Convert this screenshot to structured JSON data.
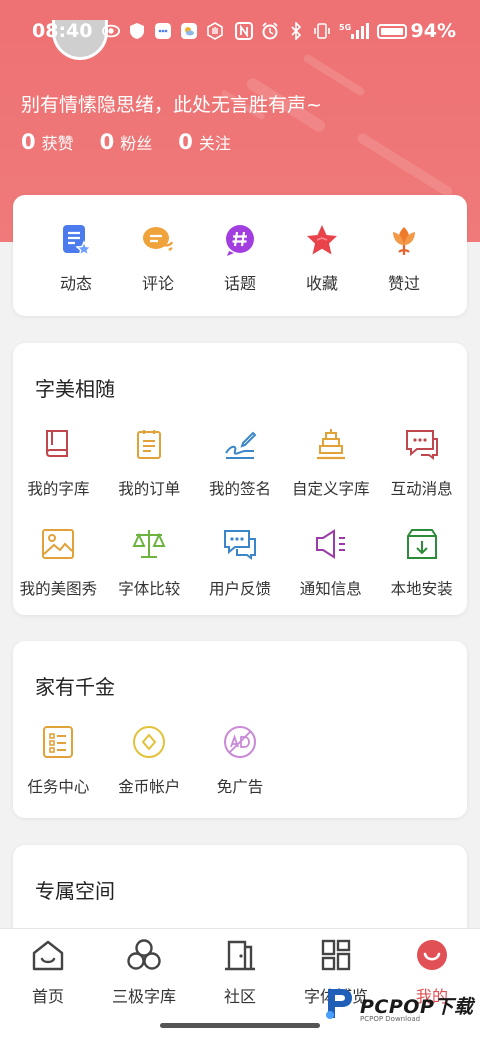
{
  "status_bar": {
    "time": "08:40",
    "battery": "94%",
    "signal": "5G"
  },
  "profile": {
    "motto": "别有情愫隐思绪，此处无言胜有声~",
    "stats": [
      {
        "num": "0",
        "label": "获赞"
      },
      {
        "num": "0",
        "label": "粉丝"
      },
      {
        "num": "0",
        "label": "关注"
      }
    ]
  },
  "quick_actions": [
    {
      "label": "动态",
      "icon": "post-icon",
      "color": "#4b7bec"
    },
    {
      "label": "评论",
      "icon": "comment-icon",
      "color": "#f0a33a"
    },
    {
      "label": "话题",
      "icon": "topic-icon",
      "color": "#a23ee0"
    },
    {
      "label": "收藏",
      "icon": "star-icon",
      "color": "#e8434b"
    },
    {
      "label": "赞过",
      "icon": "flower-icon",
      "color": "#f07a2c"
    }
  ],
  "section_ziti": {
    "title": "字美相随",
    "items": [
      {
        "label": "我的字库",
        "icon": "book-icon",
        "color": "#c0474d"
      },
      {
        "label": "我的订单",
        "icon": "clipboard-icon",
        "color": "#e1a23a"
      },
      {
        "label": "我的签名",
        "icon": "signature-icon",
        "color": "#3a86c8"
      },
      {
        "label": "自定义字库",
        "icon": "stack-icon",
        "color": "#e1a23a"
      },
      {
        "label": "互动消息",
        "icon": "message-icon",
        "color": "#c0474d"
      },
      {
        "label": "我的美图秀",
        "icon": "image-icon",
        "color": "#e1a23a"
      },
      {
        "label": "字体比较",
        "icon": "scale-icon",
        "color": "#6cb33f"
      },
      {
        "label": "用户反馈",
        "icon": "feedback-icon",
        "color": "#3a86c8"
      },
      {
        "label": "通知信息",
        "icon": "speaker-icon",
        "color": "#9b3aa8"
      },
      {
        "label": "本地安装",
        "icon": "download-box-icon",
        "color": "#2e8b3a"
      }
    ]
  },
  "section_jiayou": {
    "title": "家有千金",
    "items": [
      {
        "label": "任务中心",
        "icon": "task-icon",
        "color": "#e1a23a"
      },
      {
        "label": "金币帐户",
        "icon": "coin-icon",
        "color": "#e1c23a"
      },
      {
        "label": "免广告",
        "icon": "no-ad-icon",
        "color": "#c98ad8"
      }
    ]
  },
  "section_zhuanshu": {
    "title": "专属空间"
  },
  "bottom_nav": [
    {
      "label": "首页",
      "icon": "home-icon"
    },
    {
      "label": "三极字库",
      "icon": "circles-icon"
    },
    {
      "label": "社区",
      "icon": "door-icon"
    },
    {
      "label": "字体博览",
      "icon": "grid-icon"
    },
    {
      "label": "我的",
      "icon": "smile-icon"
    }
  ],
  "watermark": {
    "text": "PCPOP下载",
    "sub": "PCPOP Download"
  }
}
